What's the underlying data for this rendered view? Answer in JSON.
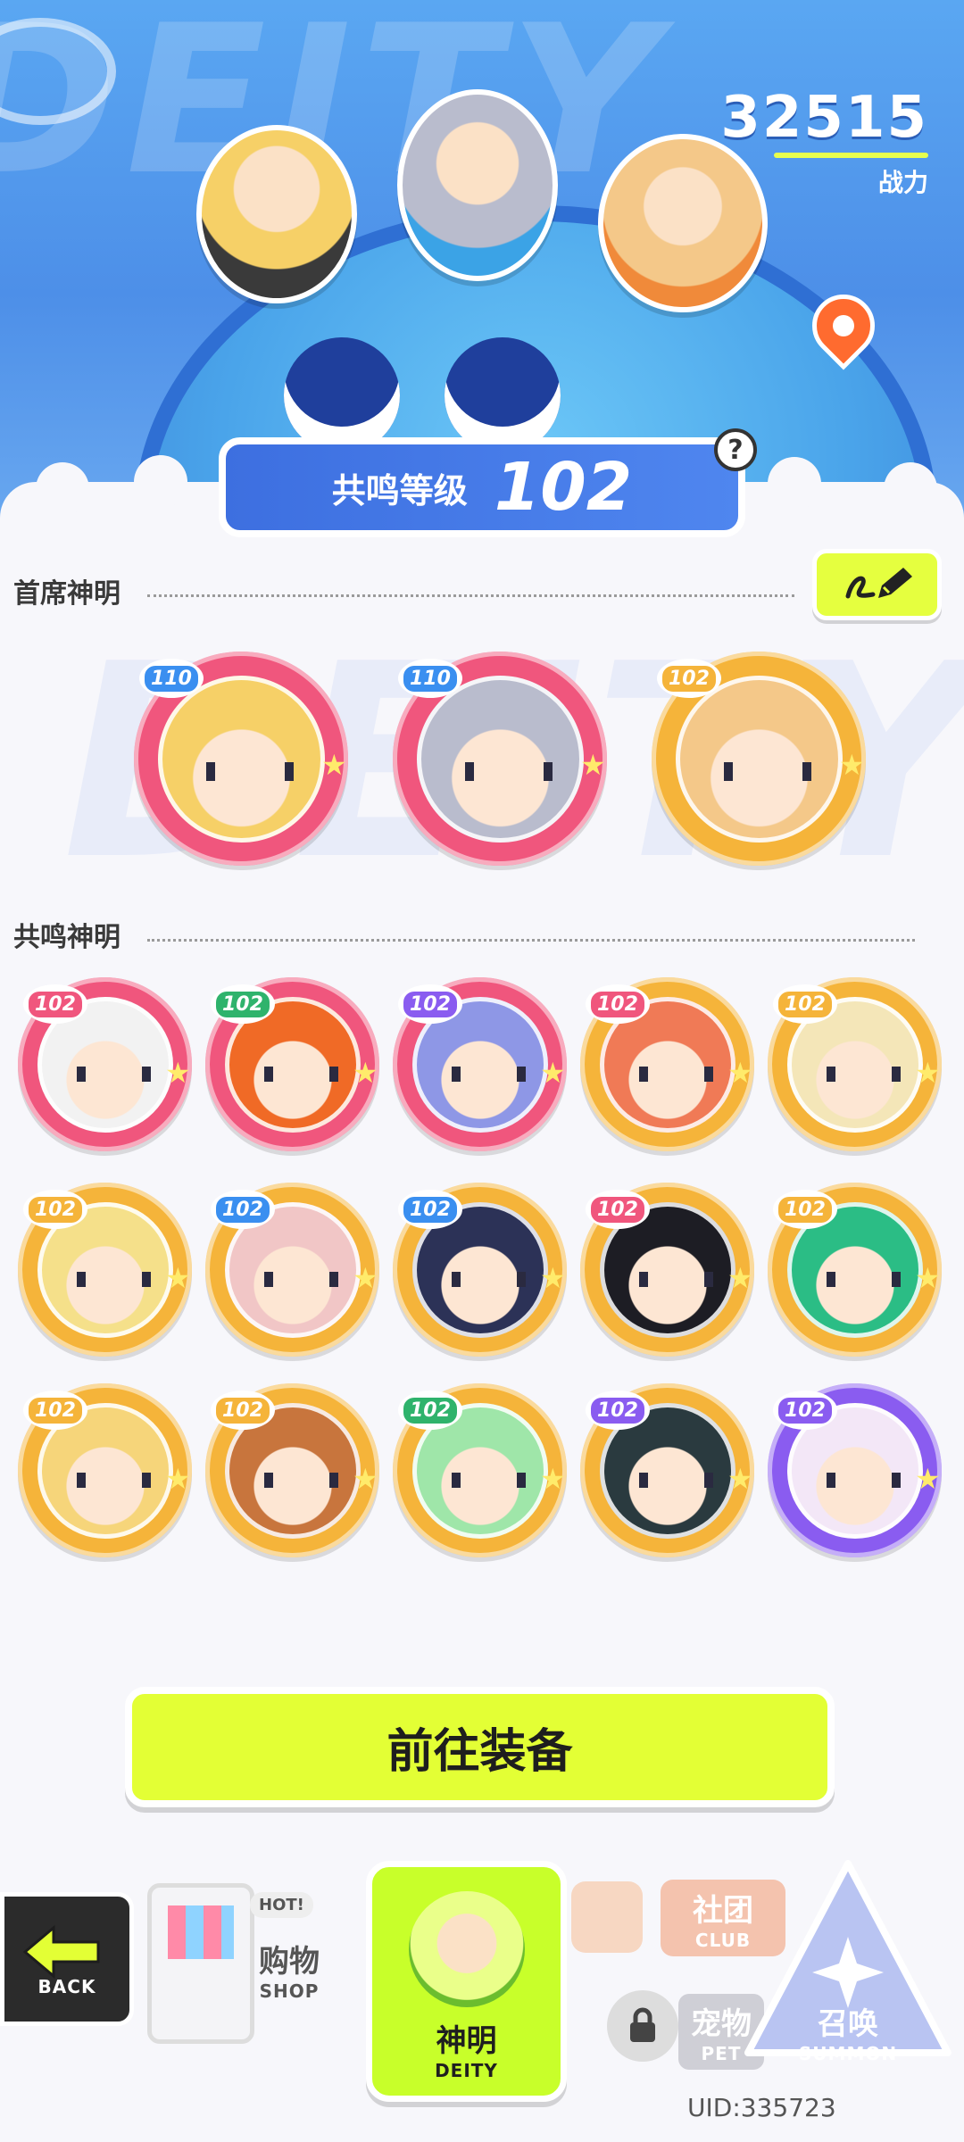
{
  "header": {
    "bg_text": "DEITY",
    "combat_power": "32515",
    "combat_power_label": "战力",
    "resonance_label": "共鸣等级",
    "resonance_level": "102",
    "help_icon": "?"
  },
  "chief": {
    "title": "首席神明",
    "edit_icon": "edit-pencil-icon",
    "members": [
      {
        "level": "110",
        "frame": "#f0567d",
        "badge": "#3a8ff0",
        "hair": "#f6d067"
      },
      {
        "level": "110",
        "frame": "#f0567d",
        "badge": "#3a8ff0",
        "hair": "#b9bccd"
      },
      {
        "level": "102",
        "frame": "#f5b43a",
        "badge": "#f5b43a",
        "hair": "#f4c889"
      }
    ]
  },
  "resonance": {
    "title": "共鸣神明",
    "members": [
      {
        "level": "102",
        "frame": "#f0567d",
        "badge": "#f0567d",
        "hair": "#f2f2f2"
      },
      {
        "level": "102",
        "frame": "#f0567d",
        "badge": "#2fb36c",
        "hair": "#f06a26"
      },
      {
        "level": "102",
        "frame": "#f0567d",
        "badge": "#8a5cf0",
        "hair": "#8e97e6"
      },
      {
        "level": "102",
        "frame": "#f5b43a",
        "badge": "#f0567d",
        "hair": "#f07a56"
      },
      {
        "level": "102",
        "frame": "#f5b43a",
        "badge": "#f5b43a",
        "hair": "#f4e6b8"
      },
      {
        "level": "102",
        "frame": "#f5b43a",
        "badge": "#f5b43a",
        "hair": "#f5e08a"
      },
      {
        "level": "102",
        "frame": "#f5b43a",
        "badge": "#3a8ff0",
        "hair": "#f1c6c6"
      },
      {
        "level": "102",
        "frame": "#f5b43a",
        "badge": "#3a8ff0",
        "hair": "#2c3257"
      },
      {
        "level": "102",
        "frame": "#f5b43a",
        "badge": "#f0567d",
        "hair": "#1d1d24"
      },
      {
        "level": "102",
        "frame": "#f5b43a",
        "badge": "#f5b43a",
        "hair": "#2bbd85"
      },
      {
        "level": "102",
        "frame": "#f5b43a",
        "badge": "#f5b43a",
        "hair": "#f6d57a"
      },
      {
        "level": "102",
        "frame": "#f5b43a",
        "badge": "#f5b43a",
        "hair": "#c8753d"
      },
      {
        "level": "102",
        "frame": "#f5b43a",
        "badge": "#2fb36c",
        "hair": "#9fe6a9"
      },
      {
        "level": "102",
        "frame": "#f5b43a",
        "badge": "#8a5cf0",
        "hair": "#2a3a3f"
      },
      {
        "level": "102",
        "frame": "#8a5cf0",
        "badge": "#8a5cf0",
        "hair": "#f3e7f7"
      }
    ]
  },
  "actions": {
    "equip": "前往装备"
  },
  "nav": {
    "back_en": "BACK",
    "shop_badge": "HOT!",
    "shop_cn": "购物",
    "shop_en": "SHOP",
    "deity_cn": "神明",
    "deity_en": "DEITY",
    "club_cn": "社团",
    "club_en": "CLUB",
    "pet_cn": "宠物",
    "pet_en": "PET",
    "summon_cn": "召唤",
    "summon_en": "SUMMON"
  },
  "uid": "UID:335723"
}
